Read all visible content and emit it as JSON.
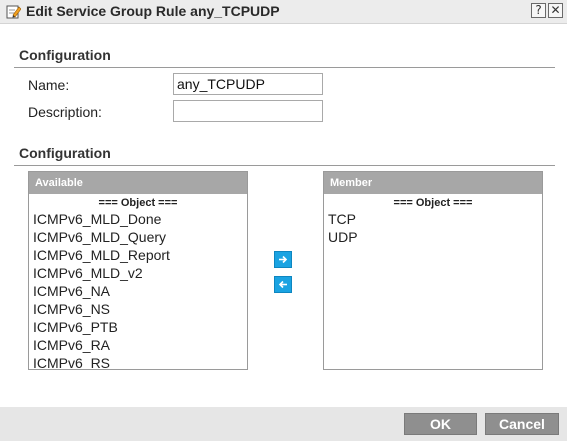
{
  "window": {
    "title": "Edit Service Group Rule any_TCPUDP",
    "help_label": "?",
    "close_label": "✕"
  },
  "sections": {
    "config_1_title": "Configuration",
    "config_2_title": "Configuration"
  },
  "form": {
    "name_label": "Name:",
    "name_value": "any_TCPUDP",
    "description_label": "Description:",
    "description_value": ""
  },
  "available": {
    "header": "Available",
    "group_title": "=== Object ===",
    "items": [
      "ICMPv6_MLD_Done",
      "ICMPv6_MLD_Query",
      "ICMPv6_MLD_Report",
      "ICMPv6_MLD_v2",
      "ICMPv6_NA",
      "ICMPv6_NS",
      "ICMPv6_PTB",
      "ICMPv6_RA",
      "ICMPv6_RS"
    ]
  },
  "member": {
    "header": "Member",
    "group_title": "=== Object ===",
    "items": [
      "TCP",
      "UDP"
    ]
  },
  "buttons": {
    "ok": "OK",
    "cancel": "Cancel"
  },
  "colors": {
    "accent": "#1aa3e2",
    "list_header": "#a7a7a7",
    "button": "#8f8f8f"
  }
}
